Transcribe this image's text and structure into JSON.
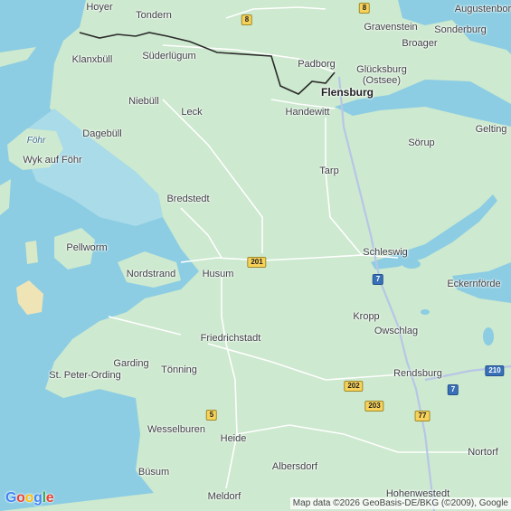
{
  "map": {
    "cities": [
      {
        "id": "hoyer",
        "name": "Hoyer"
      },
      {
        "id": "tondern",
        "name": "Tondern"
      },
      {
        "id": "augustenborg",
        "name": "Augustenbor"
      },
      {
        "id": "gravenstein",
        "name": "Gravenstein"
      },
      {
        "id": "sonderburg",
        "name": "Sonderburg"
      },
      {
        "id": "broager",
        "name": "Broager"
      },
      {
        "id": "klanxbull",
        "name": "Klanxbüll"
      },
      {
        "id": "suderlugum",
        "name": "Süderlügum"
      },
      {
        "id": "padborg",
        "name": "Padborg"
      },
      {
        "id": "glucksburg",
        "name": "Glücksburg\n(Ostsee)"
      },
      {
        "id": "flensburg",
        "name": "Flensburg",
        "major": true
      },
      {
        "id": "niebull",
        "name": "Niebüll"
      },
      {
        "id": "leck",
        "name": "Leck"
      },
      {
        "id": "handewitt",
        "name": "Handewitt"
      },
      {
        "id": "gelting",
        "name": "Gelting"
      },
      {
        "id": "dagebull",
        "name": "Dagebüll"
      },
      {
        "id": "sorup",
        "name": "Sörup"
      },
      {
        "id": "wykaufforhr",
        "name": "Wyk auf Föhr"
      },
      {
        "id": "tarp",
        "name": "Tarp"
      },
      {
        "id": "bredstedt",
        "name": "Bredstedt"
      },
      {
        "id": "pellworm",
        "name": "Pellworm"
      },
      {
        "id": "schleswig",
        "name": "Schleswig"
      },
      {
        "id": "nordstrand",
        "name": "Nordstrand"
      },
      {
        "id": "husum",
        "name": "Husum"
      },
      {
        "id": "eckernforde",
        "name": "Eckernförde"
      },
      {
        "id": "kropp",
        "name": "Kropp"
      },
      {
        "id": "owschlag",
        "name": "Owschlag"
      },
      {
        "id": "friedrichstadt",
        "name": "Friedrichstadt"
      },
      {
        "id": "garding",
        "name": "Garding"
      },
      {
        "id": "stpeterording",
        "name": "St. Peter-Ording"
      },
      {
        "id": "tonning",
        "name": "Tönning"
      },
      {
        "id": "rendsburg",
        "name": "Rendsburg"
      },
      {
        "id": "wesselburen",
        "name": "Wesselburen"
      },
      {
        "id": "heide",
        "name": "Heide"
      },
      {
        "id": "nortorf",
        "name": "Nortorf"
      },
      {
        "id": "busum",
        "name": "Büsum"
      },
      {
        "id": "albersdorf",
        "name": "Albersdorf"
      },
      {
        "id": "meldorf",
        "name": "Meldorf"
      },
      {
        "id": "hohenwestedt",
        "name": "Hohenwestedt"
      }
    ],
    "island_labels": [
      {
        "id": "fohr",
        "name": "Föhr"
      }
    ],
    "road_shields": [
      {
        "id": "b8-west",
        "label": "8",
        "kind": "federal"
      },
      {
        "id": "b8-east",
        "label": "8",
        "kind": "federal"
      },
      {
        "id": "b201",
        "label": "201",
        "kind": "federal"
      },
      {
        "id": "a7-schleswig",
        "label": "7",
        "kind": "autobahn"
      },
      {
        "id": "a210",
        "label": "210",
        "kind": "autobahn"
      },
      {
        "id": "a7-rendsburg",
        "label": "7",
        "kind": "autobahn"
      },
      {
        "id": "b202",
        "label": "202",
        "kind": "federal"
      },
      {
        "id": "b203",
        "label": "203",
        "kind": "federal"
      },
      {
        "id": "b77",
        "label": "77",
        "kind": "federal"
      },
      {
        "id": "b5",
        "label": "5",
        "kind": "federal"
      }
    ],
    "colors": {
      "land": "#cde9cf",
      "sea": "#8ccde3",
      "wadden": "#a9dbe9",
      "road": "#ffffff",
      "autobahn": "#b7c6e6",
      "border": "#2b2b2b",
      "federal_shield": "#f7d25a",
      "autobahn_shield": "#3a70b8"
    }
  },
  "branding": {
    "logo_text": "Google",
    "logo_letters": [
      {
        "ch": "G",
        "color": "#4285F4"
      },
      {
        "ch": "o",
        "color": "#EA4335"
      },
      {
        "ch": "o",
        "color": "#FBBC05"
      },
      {
        "ch": "g",
        "color": "#4285F4"
      },
      {
        "ch": "l",
        "color": "#34A853"
      },
      {
        "ch": "e",
        "color": "#EA4335"
      }
    ],
    "attribution": "Map data ©2026 GeoBasis-DE/BKG (©2009), Google"
  }
}
